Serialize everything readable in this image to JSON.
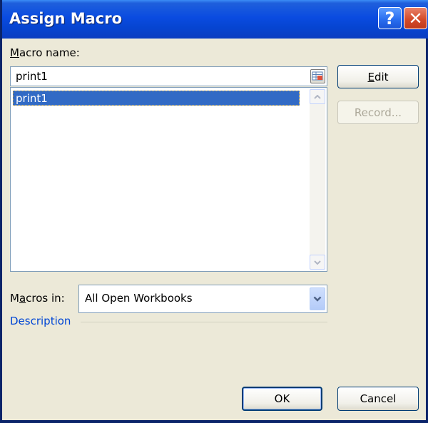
{
  "window": {
    "title": "Assign Macro",
    "help_label": "?",
    "close_label": "✕"
  },
  "macro_name": {
    "label_underlined": "M",
    "label_rest": "acro name:",
    "value": "print1"
  },
  "macro_list": {
    "items": [
      "print1"
    ],
    "selected_index": 0
  },
  "buttons": {
    "edit_underlined": "E",
    "edit_rest": "dit",
    "record": "Record...",
    "ok": "OK",
    "cancel": "Cancel"
  },
  "macros_in": {
    "label_before": "M",
    "label_underlined": "a",
    "label_rest": "cros in:",
    "value": "All Open Workbooks"
  },
  "description": {
    "label": "Description"
  },
  "colors": {
    "titlebar": "#0a4be0",
    "selection": "#316ac5",
    "group_label": "#0046d5"
  }
}
